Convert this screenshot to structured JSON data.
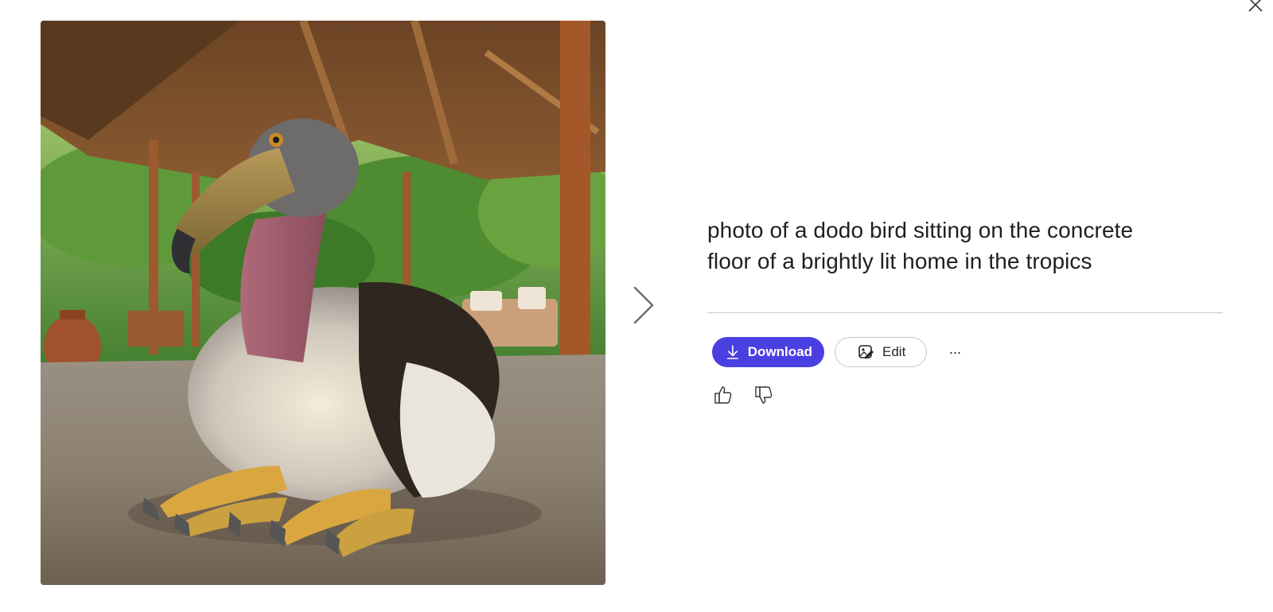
{
  "image": {
    "alt": "photo of a dodo bird sitting on the concrete floor of a brightly lit home in the tropics"
  },
  "prompt": {
    "line1": "photo of a dodo bird sitting on the concrete",
    "line2": "floor of a brightly lit home in the tropics"
  },
  "actions": {
    "download_label": "Download",
    "edit_label": "Edit",
    "more_label": "···"
  },
  "icons": {
    "close": "close-icon",
    "next": "chevron-right-icon",
    "download": "download-icon",
    "edit": "edit-image-icon",
    "like": "thumbs-up-icon",
    "dislike": "thumbs-down-icon"
  },
  "colors": {
    "accent": "#4a3fe0",
    "divider": "#c8c8c8"
  }
}
